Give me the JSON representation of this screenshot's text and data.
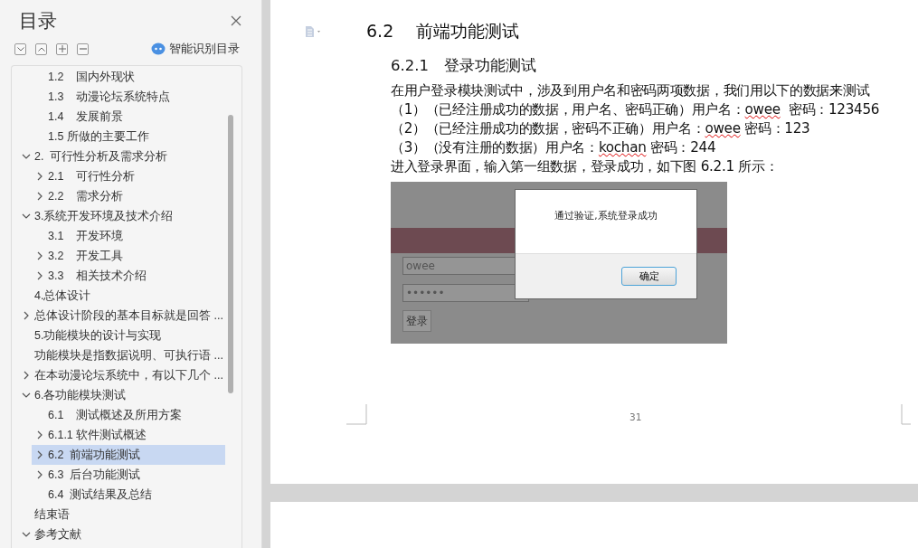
{
  "panel": {
    "title": "目录",
    "smart_button": "智能识别目录"
  },
  "toc": {
    "continued_children": [
      {
        "label": "1.2    国内外现状",
        "expandable": false,
        "selected": false
      },
      {
        "label": "1.3    动漫论坛系统特点",
        "expandable": false,
        "selected": false
      },
      {
        "label": "1.4    发展前景",
        "expandable": false,
        "selected": false
      },
      {
        "label": "1.5 所做的主要工作",
        "expandable": false,
        "selected": false
      }
    ],
    "items": [
      {
        "label": "2.  可行性分析及需求分析",
        "expandable": true,
        "expanded": true,
        "selected": false,
        "children": [
          {
            "label": "2.1    可行性分析",
            "expandable": true,
            "expanded": false,
            "selected": false
          },
          {
            "label": "2.2    需求分析",
            "expandable": true,
            "expanded": false,
            "selected": false
          }
        ]
      },
      {
        "label": "3.系统开发环境及技术介绍",
        "expandable": true,
        "expanded": true,
        "selected": false,
        "children": [
          {
            "label": "3.1    开发环境",
            "expandable": false,
            "selected": false
          },
          {
            "label": "3.2    开发工具",
            "expandable": true,
            "expanded": false,
            "selected": false
          },
          {
            "label": "3.3    相关技术介绍",
            "expandable": true,
            "expanded": false,
            "selected": false
          }
        ]
      },
      {
        "label": "4.总体设计",
        "expandable": false,
        "selected": false
      },
      {
        "label": "总体设计阶段的基本目标就是回答 ...",
        "expandable": true,
        "expanded": false,
        "selected": false
      },
      {
        "label": "5.功能模块的设计与实现",
        "expandable": false,
        "selected": false
      },
      {
        "label": "功能模块是指数据说明、可执行语 ...",
        "expandable": false,
        "selected": false
      },
      {
        "label": "在本动漫论坛系统中，有以下几个 ...",
        "expandable": true,
        "expanded": false,
        "selected": false
      },
      {
        "label": "6.各功能模块测试",
        "expandable": true,
        "expanded": true,
        "selected": false,
        "children": [
          {
            "label": "6.1    测试概述及所用方案",
            "expandable": false,
            "selected": false
          },
          {
            "label": "6.1.1 软件测试概述",
            "expandable": true,
            "expanded": false,
            "selected": false
          },
          {
            "label": "6.2  前端功能测试",
            "expandable": true,
            "expanded": false,
            "selected": true
          },
          {
            "label": "6.3  后台功能测试",
            "expandable": true,
            "expanded": false,
            "selected": false
          },
          {
            "label": "6.4  测试结果及总结",
            "expandable": false,
            "selected": false
          }
        ]
      },
      {
        "label": "结束语",
        "expandable": false,
        "selected": false
      },
      {
        "label": "参考文献",
        "expandable": true,
        "expanded": true,
        "selected": false
      }
    ]
  },
  "document": {
    "heading": "6.2　 前端功能测试",
    "subheading": "6.2.1　登录功能测试",
    "lines": [
      [
        {
          "text": "在用户登录模块测试中，涉及到用户名和密码两项数据，我们用以下的数据来测试"
        }
      ],
      [
        {
          "text": "（1）（已经注册成功的数据，用户名、密码正确）用户名："
        },
        {
          "text": "owee",
          "misspelled": true
        },
        {
          "text": "  密码：123456"
        }
      ],
      [
        {
          "text": "（2）（已经注册成功的数据，密码不正确）用户名："
        },
        {
          "text": "owee",
          "misspelled": true
        },
        {
          "text": " 密码：123"
        }
      ],
      [
        {
          "text": "（3）（没有注册的数据）用户名："
        },
        {
          "text": "kochan",
          "misspelled": true
        },
        {
          "text": " 密码：244"
        }
      ],
      [
        {
          "text": "进入登录界面，输入第一组数据，登录成功，如下图 6.2.1 所示："
        }
      ]
    ],
    "figure": {
      "username": "owee",
      "password": "••••••",
      "login_button": "登录",
      "dialog_message": "通过验证,系统登录成功",
      "dialog_button": "确定"
    },
    "page_number": "31"
  }
}
